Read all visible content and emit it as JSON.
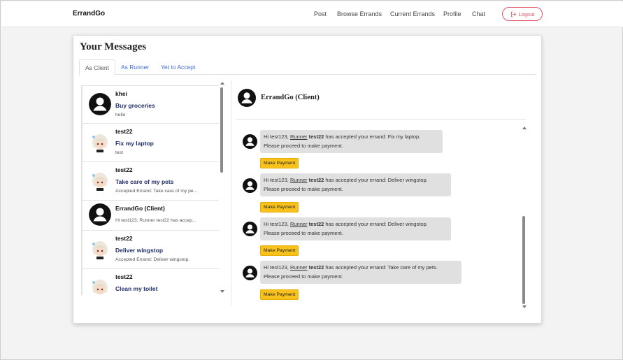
{
  "navbar": {
    "brand": "ErrandGo",
    "links": [
      "Post",
      "Browse Errands",
      "Current Errands",
      "Profile",
      "Chat"
    ],
    "logout_label": "Logout"
  },
  "page": {
    "title": "Your Messages",
    "tabs": [
      "As Client",
      "As Runner",
      "Yet to Accept"
    ],
    "active_tab": "As Client"
  },
  "conversations": [
    {
      "name": "khei",
      "errand": "Buy groceries",
      "preview": "hello",
      "avatar": "default-avatar-icon"
    },
    {
      "name": "test22",
      "errand": "Fix my laptop",
      "preview": "test",
      "avatar": "anime-avatar"
    },
    {
      "name": "test22",
      "errand": "Take care of my pets",
      "preview": "Accepted Errand: Take care of my pe...",
      "avatar": "anime-avatar"
    },
    {
      "name": "ErrandGo (Client)",
      "errand": "",
      "preview": "Hi test123, Runner test22 has accep...",
      "avatar": "default-avatar-icon"
    },
    {
      "name": "test22",
      "errand": "Deliver wingstop",
      "preview": "Accepted Errand: Deliver wingstop.",
      "avatar": "anime-avatar"
    },
    {
      "name": "test22",
      "errand": "Clean my toilet",
      "preview": "",
      "avatar": "anime-avatar"
    }
  ],
  "chat": {
    "header_name": "ErrandGo (Client)",
    "messages": [
      {
        "greeting": "Hi test123, ",
        "runner_label": "Runner",
        "runner_name": "test22",
        "rest": " has accepted your errand: Fix my laptop.",
        "line2": "Please proceed to make payment.",
        "button": "Make Payment"
      },
      {
        "greeting": "Hi test123, ",
        "runner_label": "Runner",
        "runner_name": "test22",
        "rest": " has accepted your errand: Deliver wingstop.",
        "line2": "Please proceed to make payment.",
        "button": "Make Payment"
      },
      {
        "greeting": "Hi test123, ",
        "runner_label": "Runner",
        "runner_name": "test22",
        "rest": " has accepted your errand: Deliver wingstop.",
        "line2": "Please proceed to make payment.",
        "button": "Make Payment"
      },
      {
        "greeting": "Hi test123, ",
        "runner_label": "Runner",
        "runner_name": "test22",
        "rest": " has accepted your errand: Take care of my pets.",
        "line2": "Please proceed to make payment.",
        "button": "Make Payment"
      }
    ]
  },
  "colors": {
    "accent_link": "#3d6adb",
    "logout": "#e05567",
    "pay_button": "#f8c11b",
    "errand_title": "#1f2f6b"
  }
}
